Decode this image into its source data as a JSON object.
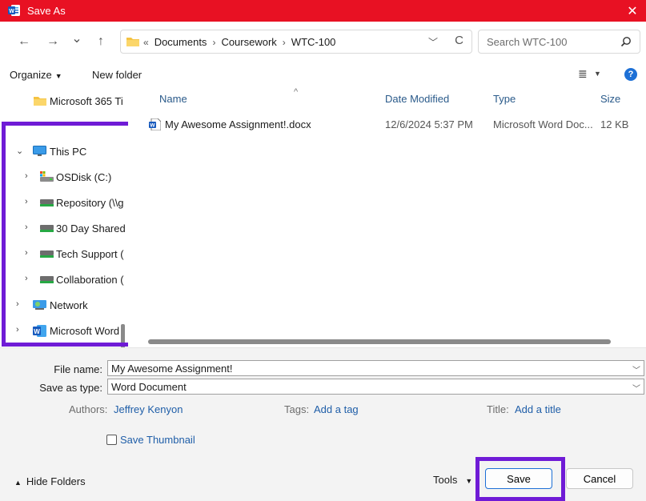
{
  "window": {
    "title": "Save As",
    "close_glyph": "✕",
    "app_icon": "word-icon",
    "accent": "#e81123"
  },
  "nav": {
    "back_glyph": "←",
    "forward_glyph": "→",
    "recent_glyph": "⌄",
    "up_glyph": "↑",
    "breadcrumb_overflow": "«",
    "breadcrumb": [
      "Documents",
      "Coursework",
      "WTC-100"
    ],
    "refresh_glyph": "C",
    "search_placeholder": "Search WTC-100"
  },
  "toolbar": {
    "organize_label": "Organize",
    "new_folder_label": "New folder",
    "help_label": "?"
  },
  "sidebar": {
    "items": [
      {
        "label": "Microsoft 365 Ti",
        "icon": "folder-icon"
      },
      {
        "label": "This PC",
        "icon": "monitor-icon",
        "expanded": true
      },
      {
        "label": "OSDisk (C:)",
        "icon": "disk-icon"
      },
      {
        "label": "Repository (\\\\g",
        "icon": "network-drive-icon"
      },
      {
        "label": "30 Day Shared",
        "icon": "network-drive-icon"
      },
      {
        "label": "Tech Support (",
        "icon": "network-drive-icon"
      },
      {
        "label": "Collaboration (",
        "icon": "network-drive-icon"
      },
      {
        "label": "Network",
        "icon": "network-icon"
      },
      {
        "label": "Microsoft Word",
        "icon": "word-icon"
      }
    ]
  },
  "filelist": {
    "columns": [
      "Name",
      "Date Modified",
      "Type",
      "Size"
    ],
    "rows": [
      {
        "name": "My Awesome Assignment!.docx",
        "date": "12/6/2024 5:37 PM",
        "type": "Microsoft Word Doc...",
        "size": "12 KB"
      }
    ]
  },
  "form": {
    "file_name_label": "File name:",
    "file_name_value": "My Awesome Assignment!",
    "save_type_label": "Save as type:",
    "save_type_value": "Word Document",
    "authors_label": "Authors:",
    "authors_value": "Jeffrey Kenyon",
    "tags_label": "Tags:",
    "tags_value": "Add a tag",
    "title_label": "Title:",
    "title_value": "Add a title",
    "thumbnail_label": "Save Thumbnail"
  },
  "footer": {
    "hide_folders_label": "Hide Folders",
    "tools_label": "Tools",
    "save_label": "Save",
    "cancel_label": "Cancel"
  },
  "highlight_color": "#6f1bd6"
}
